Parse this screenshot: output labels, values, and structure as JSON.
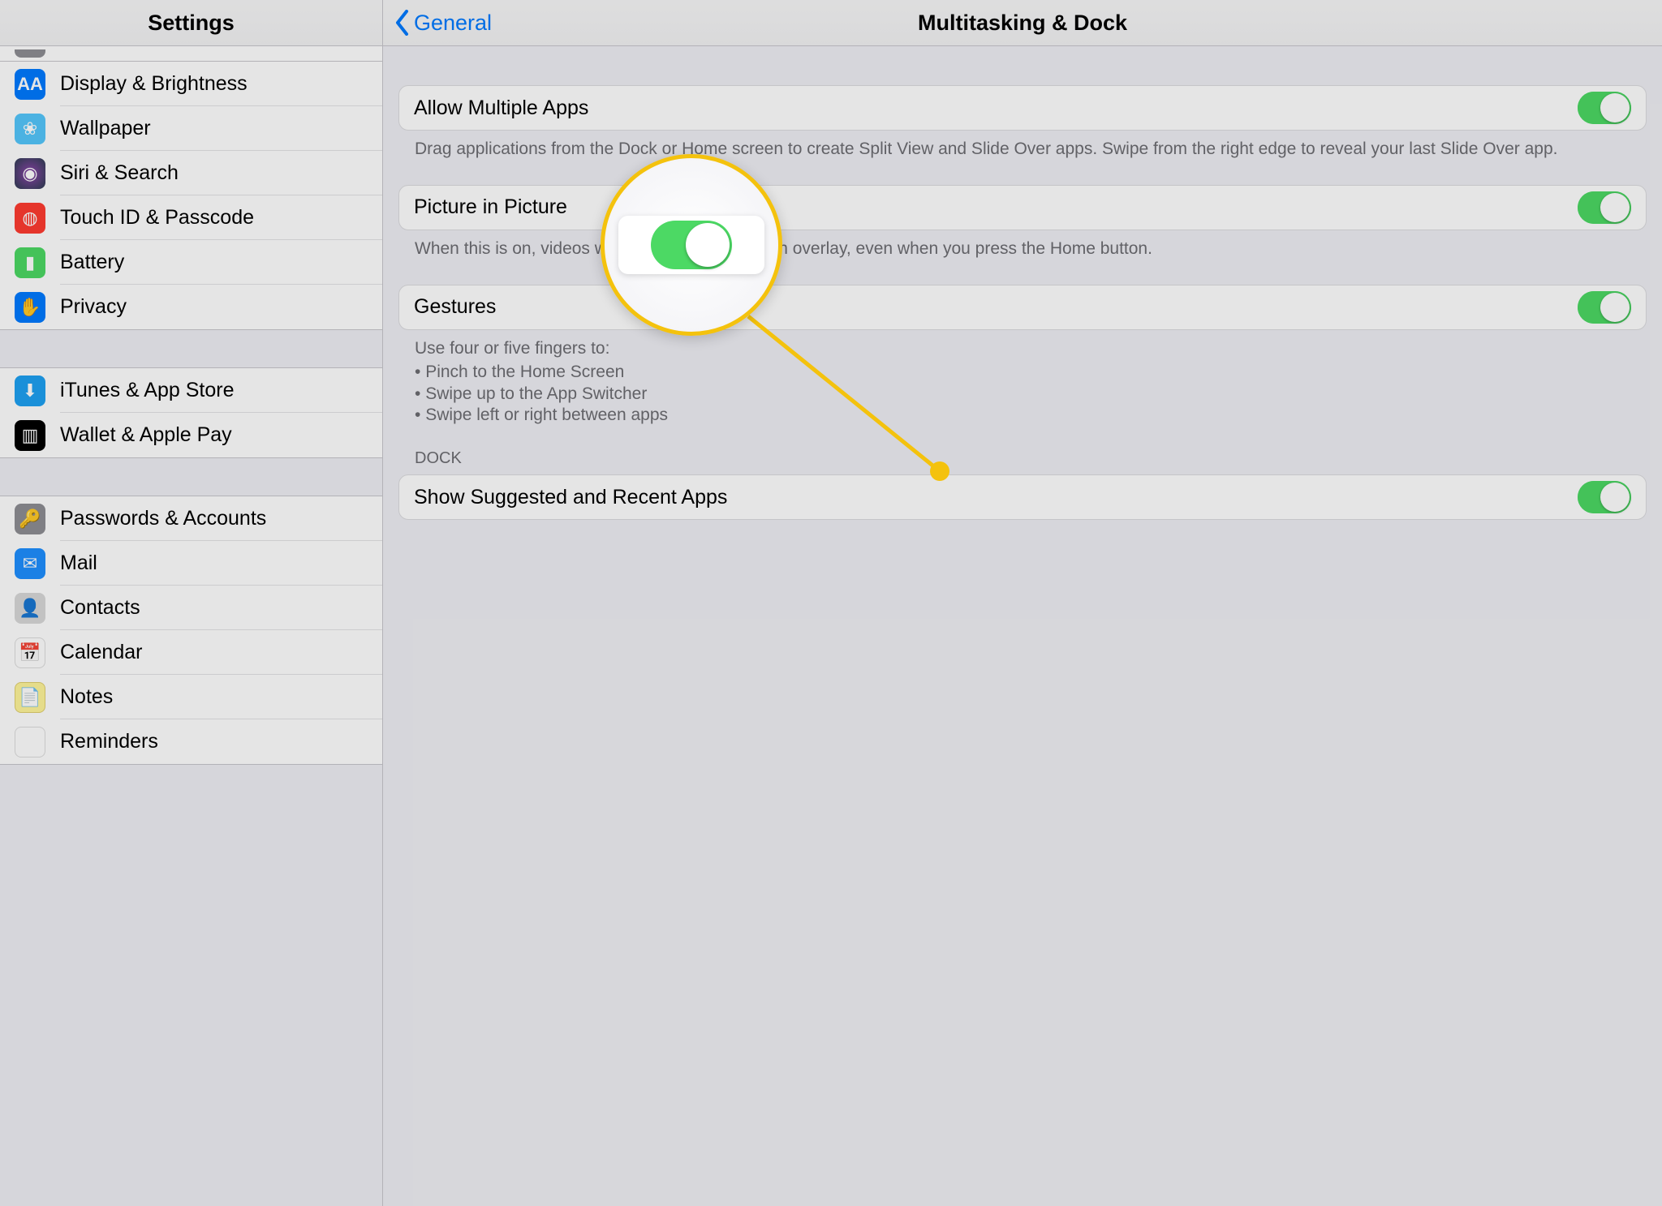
{
  "sidebar": {
    "title": "Settings",
    "groups": [
      [
        {
          "key": "display",
          "label": "Display & Brightness",
          "icon": "AA"
        },
        {
          "key": "wallpaper",
          "label": "Wallpaper",
          "icon": "❀"
        },
        {
          "key": "siri",
          "label": "Siri & Search",
          "icon": "◉"
        },
        {
          "key": "touchid",
          "label": "Touch ID & Passcode",
          "icon": "◍"
        },
        {
          "key": "battery",
          "label": "Battery",
          "icon": "▮"
        },
        {
          "key": "privacy",
          "label": "Privacy",
          "icon": "✋"
        }
      ],
      [
        {
          "key": "itunes",
          "label": "iTunes & App Store",
          "icon": "⬇"
        },
        {
          "key": "wallet",
          "label": "Wallet & Apple Pay",
          "icon": "▥"
        }
      ],
      [
        {
          "key": "passwords",
          "label": "Passwords & Accounts",
          "icon": "🔑"
        },
        {
          "key": "mail",
          "label": "Mail",
          "icon": "✉"
        },
        {
          "key": "contacts",
          "label": "Contacts",
          "icon": "👤"
        },
        {
          "key": "calendar",
          "label": "Calendar",
          "icon": "📅"
        },
        {
          "key": "notes",
          "label": "Notes",
          "icon": "📄"
        },
        {
          "key": "reminders",
          "label": "Reminders",
          "icon": "⋮"
        }
      ]
    ]
  },
  "detail": {
    "back_label": "General",
    "title": "Multitasking & Dock",
    "settings": {
      "allow_multiple": {
        "label": "Allow Multiple Apps",
        "desc": "Drag applications from the Dock or Home screen to create Split View and Slide Over apps. Swipe from the right edge to reveal your last Slide Over app.",
        "on": true
      },
      "pip": {
        "label": "Picture in Picture",
        "desc": "When this is on, videos will continue playing in an overlay, even when you press the Home button.",
        "on": true
      },
      "gestures": {
        "label": "Gestures",
        "desc_header": "Use four or five fingers to:",
        "desc_items": [
          "Pinch to the Home Screen",
          "Swipe up to the App Switcher",
          "Swipe left or right between apps"
        ],
        "on": true
      }
    },
    "dock_header": "DOCK",
    "dock": {
      "show_suggested": {
        "label": "Show Suggested and Recent Apps",
        "on": true
      }
    }
  },
  "callout": {
    "target": "show-suggested-toggle"
  }
}
